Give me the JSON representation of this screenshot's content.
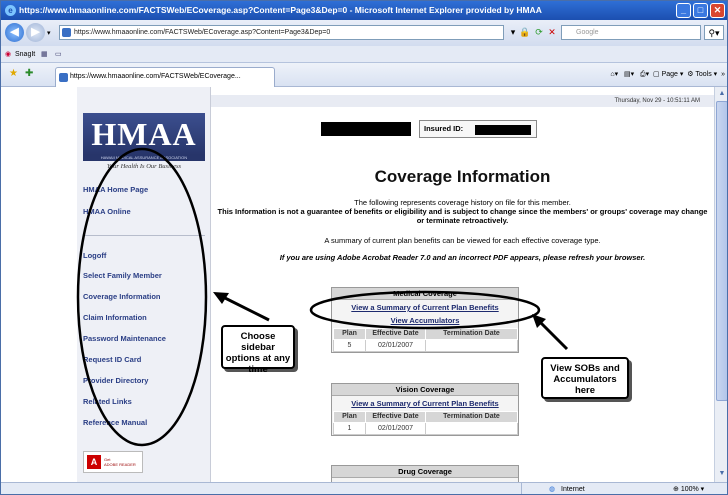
{
  "window": {
    "title": "https://www.hmaaonline.com/FACTSWeb/ECoverage.asp?Content=Page3&Dep=0 - Microsoft Internet Explorer provided by HMAA"
  },
  "addressbar": {
    "url": "https://www.hmaaonline.com/FACTSWeb/ECoverage.asp?Content=Page3&Dep=0",
    "search_placeholder": "Google"
  },
  "linksbar": {
    "snagit_label": "SnagIt"
  },
  "tab": {
    "title": "https://www.hmaaonline.com/FACTSWeb/ECoverage...",
    "page_menu": "Page",
    "tools_menu": "Tools"
  },
  "statusbar": {
    "zone": "Internet",
    "zoom": "100%"
  },
  "page": {
    "date": "Thursday, Nov 29 - 10:51:11 AM",
    "insured_label": "Insured ID:",
    "heading": "Coverage Information",
    "para1": "The following represents coverage history on file for this member.",
    "para2": "This Information is not a guarantee of benefits or eligibility and is subject to change since the members' or groups' coverage may change or terminate retroactively.",
    "para3": "A summary of current plan benefits can be viewed for each effective coverage type.",
    "para4": "If you are using Adobe Acrobat Reader 7.0 and an incorrect PDF appears, please refresh your browser."
  },
  "logo": {
    "text": "HMAA",
    "subtext": "HAWAII MEDICAL ASSURANCE ASSOCIATION",
    "tagline": "Your Health Is Our Business"
  },
  "sidebar": {
    "items": [
      {
        "label": "HMAA Home Page"
      },
      {
        "label": "HMAA Online"
      },
      {
        "label": "Logoff"
      },
      {
        "label": "Select Family Member"
      },
      {
        "label": "Coverage Information"
      },
      {
        "label": "Claim Information"
      },
      {
        "label": "Password Maintenance"
      },
      {
        "label": "Request ID Card"
      },
      {
        "label": "Provider Directory"
      },
      {
        "label": "Related Links"
      },
      {
        "label": "Reference Manual"
      }
    ]
  },
  "coverage": {
    "medical": {
      "title": "Medical Coverage",
      "summary_link": "View a Summary of Current Plan Benefits",
      "accum_link": "View Accumulators",
      "headers": [
        "Plan",
        "Effective Date",
        "Termination Date"
      ],
      "row": [
        "5",
        "02/01/2007",
        ""
      ]
    },
    "vision": {
      "title": "Vision Coverage",
      "summary_link": "View a Summary of Current Plan Benefits",
      "headers": [
        "Plan",
        "Effective Date",
        "Termination Date"
      ],
      "row": [
        "1",
        "02/01/2007",
        ""
      ]
    },
    "drug": {
      "title": "Drug Coverage"
    }
  },
  "annotations": {
    "sidebar_note": "Choose sidebar options at any time",
    "sob_note": "View SOBs and Accumulators here"
  }
}
